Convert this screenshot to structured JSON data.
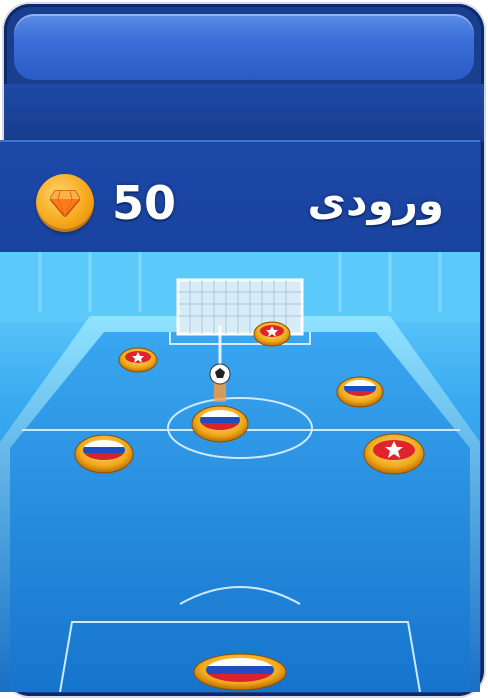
{
  "header": {
    "coin_icon": "diamond-coin-icon",
    "coin_amount": "50",
    "entry_label": "ورودی"
  },
  "colors": {
    "panel": "#1a3f8f",
    "header": "#1c48a8",
    "field": "#1e88d6",
    "coin": "#f7a81c",
    "star_piece": "#e0242c"
  },
  "pieces": [
    {
      "team": "star",
      "icon": "red-star-piece-icon"
    },
    {
      "team": "star",
      "icon": "red-star-piece-icon"
    },
    {
      "team": "flag",
      "icon": "russia-flag-piece-icon"
    },
    {
      "team": "flag",
      "icon": "russia-flag-piece-icon"
    },
    {
      "team": "flag",
      "icon": "russia-flag-piece-icon"
    },
    {
      "team": "star",
      "icon": "red-star-piece-icon"
    },
    {
      "team": "flag",
      "icon": "russia-flag-piece-icon"
    }
  ]
}
